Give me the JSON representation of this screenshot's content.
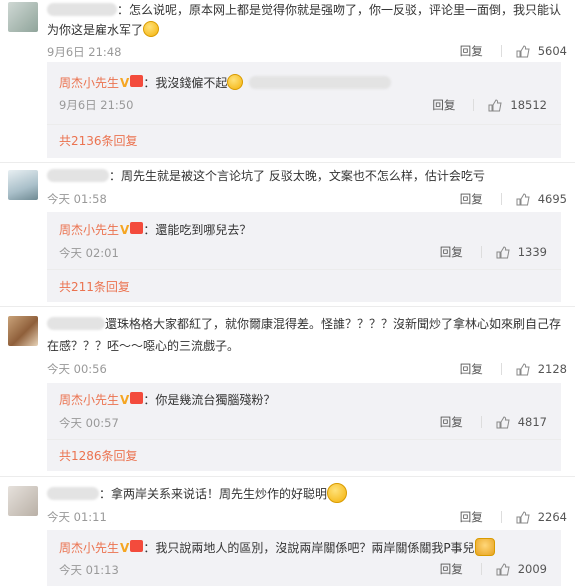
{
  "comments": [
    {
      "text": "：怎么说呢，原本网上都是觉得你就是强吻了，你一反驳，评论里一面倒，我只能认为你这是雇水军了",
      "time": "9月6日 21:48",
      "reply_label": "回复",
      "likes": "5604",
      "reply": {
        "name": "周杰小先生",
        "text": "：我沒錢僱不起",
        "time": "9月6日 21:50",
        "reply_label": "回复",
        "likes": "18512"
      },
      "more": "共2136条回复"
    },
    {
      "text": "：周先生就是被这个言论坑了 反驳太晚，文案也不怎么样，估计会吃亏",
      "time": "今天 01:58",
      "reply_label": "回复",
      "likes": "4695",
      "reply": {
        "name": "周杰小先生",
        "text": "：還能吃到哪兒去？",
        "time": "今天 02:01",
        "reply_label": "回复",
        "likes": "1339"
      },
      "more": "共211条回复"
    },
    {
      "text1": "還珠格格大家都紅了，就你爾康混得差。怪誰？？？？沒新聞炒了拿林心如來刷自己存",
      "text2": "在感？？？呸～～噁心的三流戲子。",
      "time": "今天 00:56",
      "reply_label": "回复",
      "likes": "2128",
      "reply": {
        "name": "周杰小先生",
        "text": "：你是幾流台獨腦殘粉？",
        "time": "今天 00:57",
        "reply_label": "回复",
        "likes": "4817"
      },
      "more": "共1286条回复"
    },
    {
      "text": "：拿两岸关系来说话！周先生炒作的好聪明",
      "time": "今天 01:11",
      "reply_label": "回复",
      "likes": "2264",
      "reply": {
        "name": "周杰小先生",
        "text": "：我只說兩地人的區別，沒說兩岸關係吧？兩岸關係關我P事兒",
        "time": "今天 01:13",
        "reply_label": "回复",
        "likes": "2009"
      }
    }
  ],
  "badges": {
    "v": "V",
    "vip": "☆"
  },
  "colors": {
    "name": "#eb7350",
    "badge_v": "#f5a623",
    "reply_bg": "#f2f2f5"
  }
}
